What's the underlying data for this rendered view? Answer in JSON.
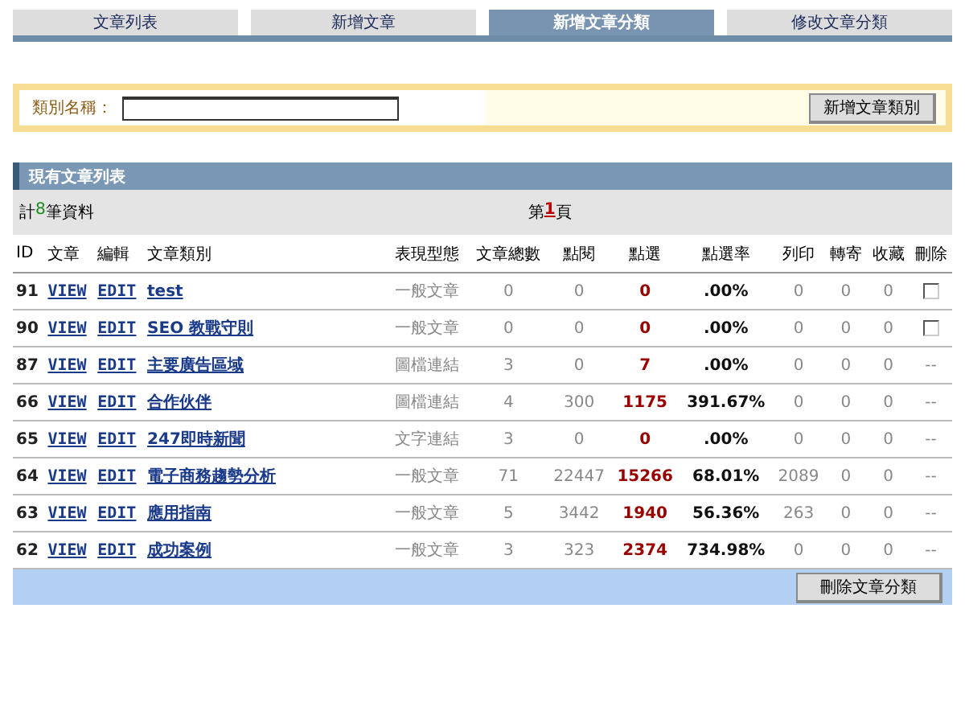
{
  "tabs": [
    {
      "label": "文章列表",
      "selected": false
    },
    {
      "label": "新增文章",
      "selected": false
    },
    {
      "label": "新增文章分類",
      "selected": true
    },
    {
      "label": "修改文章分類",
      "selected": false
    }
  ],
  "form": {
    "label": "類別名稱：",
    "button": "新增文章類別"
  },
  "list": {
    "title": "現有文章列表",
    "count_prefix": "計",
    "count": "8",
    "count_suffix": "筆資料",
    "page_prefix": "第",
    "page": "1",
    "page_suffix": "頁",
    "columns": [
      "ID",
      "文章",
      "編輯",
      "文章類別",
      "表現型態",
      "文章總數",
      "點閱",
      "點選",
      "點選率",
      "列印",
      "轉寄",
      "收藏",
      "刪除"
    ],
    "rows": [
      {
        "id": "91",
        "view": "VIEW",
        "edit": "EDIT",
        "category": "test",
        "type": "一般文章",
        "total": "0",
        "views": "0",
        "clicks": "0",
        "rate": ".00%",
        "print": "0",
        "forward": "0",
        "favorite": "0",
        "delete": {
          "kind": "checkbox",
          "checked": false
        }
      },
      {
        "id": "90",
        "view": "VIEW",
        "edit": "EDIT",
        "category": "SEO 教戰守則",
        "type": "一般文章",
        "total": "0",
        "views": "0",
        "clicks": "0",
        "rate": ".00%",
        "print": "0",
        "forward": "0",
        "favorite": "0",
        "delete": {
          "kind": "checkbox",
          "checked": false
        }
      },
      {
        "id": "87",
        "view": "VIEW",
        "edit": "EDIT",
        "category": "主要廣告區域",
        "type": "圖檔連結",
        "total": "3",
        "views": "0",
        "clicks": "7",
        "rate": ".00%",
        "print": "0",
        "forward": "0",
        "favorite": "0",
        "delete": {
          "kind": "text",
          "text": "--"
        }
      },
      {
        "id": "66",
        "view": "VIEW",
        "edit": "EDIT",
        "category": "合作伙伴",
        "type": "圖檔連結",
        "total": "4",
        "views": "300",
        "clicks": "1175",
        "rate": "391.67%",
        "print": "0",
        "forward": "0",
        "favorite": "0",
        "delete": {
          "kind": "text",
          "text": "--"
        }
      },
      {
        "id": "65",
        "view": "VIEW",
        "edit": "EDIT",
        "category": "247即時新聞",
        "type": "文字連結",
        "total": "3",
        "views": "0",
        "clicks": "0",
        "rate": ".00%",
        "print": "0",
        "forward": "0",
        "favorite": "0",
        "delete": {
          "kind": "text",
          "text": "--"
        }
      },
      {
        "id": "64",
        "view": "VIEW",
        "edit": "EDIT",
        "category": "電子商務趨勢分析",
        "type": "一般文章",
        "total": "71",
        "views": "22447",
        "clicks": "15266",
        "rate": "68.01%",
        "print": "2089",
        "forward": "0",
        "favorite": "0",
        "delete": {
          "kind": "text",
          "text": "--"
        }
      },
      {
        "id": "63",
        "view": "VIEW",
        "edit": "EDIT",
        "category": "應用指南",
        "type": "一般文章",
        "total": "5",
        "views": "3442",
        "clicks": "1940",
        "rate": "56.36%",
        "print": "263",
        "forward": "0",
        "favorite": "0",
        "delete": {
          "kind": "text",
          "text": "--"
        }
      },
      {
        "id": "62",
        "view": "VIEW",
        "edit": "EDIT",
        "category": "成功案例",
        "type": "一般文章",
        "total": "3",
        "views": "323",
        "clicks": "2374",
        "rate": "734.98%",
        "print": "0",
        "forward": "0",
        "favorite": "0",
        "delete": {
          "kind": "text",
          "text": "--"
        }
      }
    ],
    "button": "刪除文章分類"
  }
}
